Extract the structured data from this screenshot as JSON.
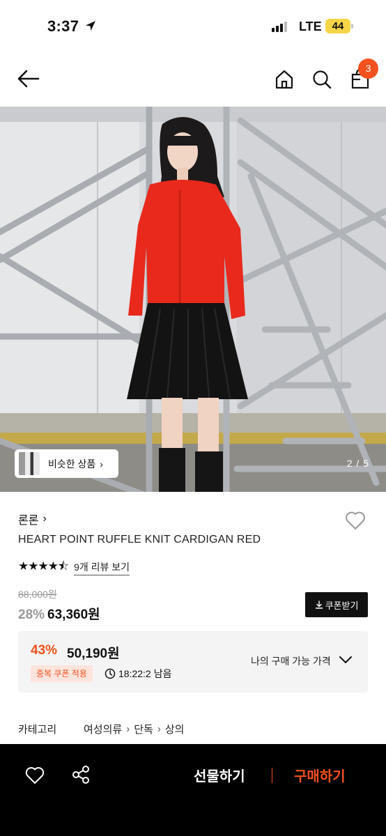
{
  "status_bar": {
    "time": "3:37",
    "network": "LTE",
    "battery": "44"
  },
  "nav": {
    "cart_count": "3"
  },
  "hero": {
    "similar_label": "비슷한 상품",
    "similar_chevron": "›",
    "pager": "2 / 5"
  },
  "product": {
    "brand": "론론",
    "brand_chevron": "›",
    "title": "HEART POINT RUFFLE KNIT CARDIGAN RED",
    "rating": 4.5,
    "stars": "★★★★⯪",
    "review_link": "9개 리뷰 보기",
    "original_price": "88,000원",
    "sale_rate": "28%",
    "sale_price": "63,360원",
    "coupon_button": "쿠폰받기"
  },
  "my_price": {
    "rate": "43%",
    "price": "50,190원",
    "dup_badge": "중복 쿠폰 적용",
    "timer": "18:22:2",
    "timer_suffix": "남음",
    "label": "나의 구매 가능 가격"
  },
  "category": {
    "label": "카테고리",
    "crumbs": [
      "여성의류",
      "단독",
      "상의"
    ],
    "sep": "›"
  },
  "bottom_bar": {
    "gift_label": "선물하기",
    "buy_label": "구매하기"
  },
  "colors": {
    "accent": "#f4511e",
    "battery": "#f5d547",
    "dark": "#111111"
  }
}
